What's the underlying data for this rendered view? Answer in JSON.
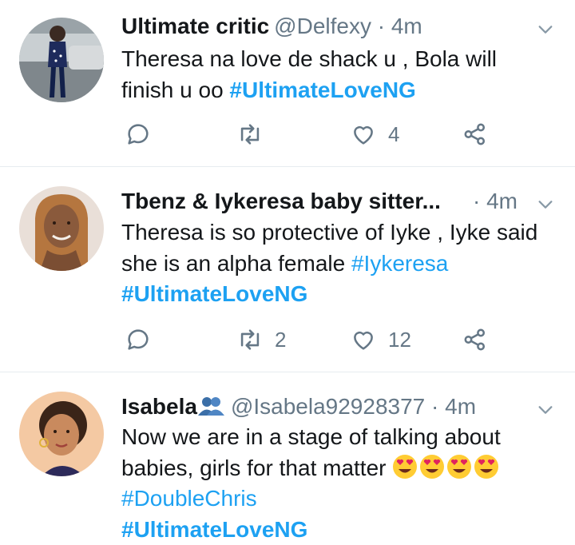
{
  "tweets": [
    {
      "name": "Ultimate critic",
      "handle": "@Delfexy",
      "time": "· 4m",
      "text": "Theresa na love de shack u , Bola will finish u oo ",
      "hashtag": "#UltimateLoveNG",
      "replies": "",
      "retweets": "",
      "likes": "4"
    },
    {
      "name": "Tbenz & Iykeresa baby sitter...",
      "time": "· 4m",
      "text": "Theresa is so protective of Iyke , Iyke said she is an alpha female ",
      "hashtag1": "#Iykeresa",
      "hashtag2": "#UltimateLoveNG",
      "replies": "",
      "retweets": "2",
      "likes": "12"
    },
    {
      "name": "Isabela",
      "handle": "@Isabela92928377",
      "time": "· 4m",
      "text": "Now we are in a stage of talking about babies, girls for that matter ",
      "emoji_count": 4,
      "hashtag1": "#DoubleChris",
      "hashtag2": "#UltimateLoveNG"
    }
  ],
  "colors": {
    "link": "#1da1f2",
    "muted": "#657786",
    "text": "#14171a",
    "divider": "#e6ecf0"
  },
  "icons": [
    "reply-icon",
    "retweet-icon",
    "like-icon",
    "share-icon",
    "chevron-down-icon",
    "people-icon",
    "heart-eyes-emoji"
  ]
}
